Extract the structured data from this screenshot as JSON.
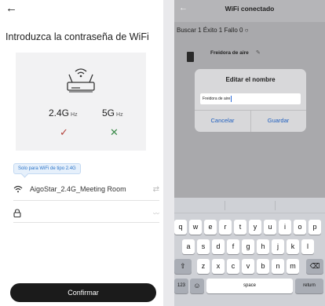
{
  "left": {
    "back_glyph": "←",
    "title": "Introduzca la contraseña de WiFi",
    "bands": [
      {
        "main": "2.4G",
        "unit": "Hz",
        "mark": "✓"
      },
      {
        "main": "5G",
        "unit": "Hz",
        "mark": "✕"
      }
    ],
    "hint": "Solo para WiFi de tipo 2.4G",
    "ssid": "AigoStar_2.4G_Meeting Room",
    "swap_glyph": "⇄",
    "eye_glyph": "〰",
    "confirm": "Confirmar"
  },
  "right": {
    "back_glyph": "←",
    "title": "WiFi conectado",
    "status": "Buscar 1  Éxito 1  Fallo 0  ○",
    "device_name": "Freidora de aire",
    "edit_glyph": "✎",
    "dialog": {
      "title": "Editar el nombre",
      "input_value": "Freidora de aire",
      "cancel": "Cancelar",
      "save": "Guardar"
    },
    "keyboard": {
      "row1": [
        "q",
        "w",
        "e",
        "r",
        "t",
        "y",
        "u",
        "i",
        "o",
        "p"
      ],
      "row2": [
        "a",
        "s",
        "d",
        "f",
        "g",
        "h",
        "j",
        "k",
        "l"
      ],
      "row3": [
        "z",
        "x",
        "c",
        "v",
        "b",
        "n",
        "m"
      ],
      "shift": "⇧",
      "backspace": "⌫",
      "numbers": "123",
      "emoji": "☺",
      "space": "space",
      "return": "return"
    }
  }
}
